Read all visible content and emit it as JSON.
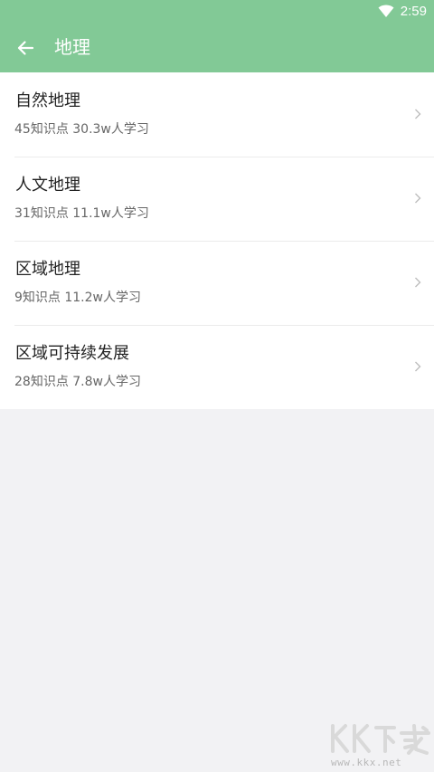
{
  "status_bar": {
    "time": "2:59",
    "wifi_icon": "wifi-icon"
  },
  "app_bar": {
    "title": "地理",
    "back_icon": "arrow-left-icon",
    "background": "#82c996"
  },
  "topics": [
    {
      "name": "自然地理",
      "meta": "45知识点 30.3w人学习"
    },
    {
      "name": "人文地理",
      "meta": "31知识点 11.1w人学习"
    },
    {
      "name": "区域地理",
      "meta": "9知识点 11.2w人学习"
    },
    {
      "name": "区域可持续发展",
      "meta": "28知识点 7.8w人学习"
    }
  ],
  "watermark": {
    "logo_text": "KK下载",
    "url": "www.kkx.net"
  }
}
